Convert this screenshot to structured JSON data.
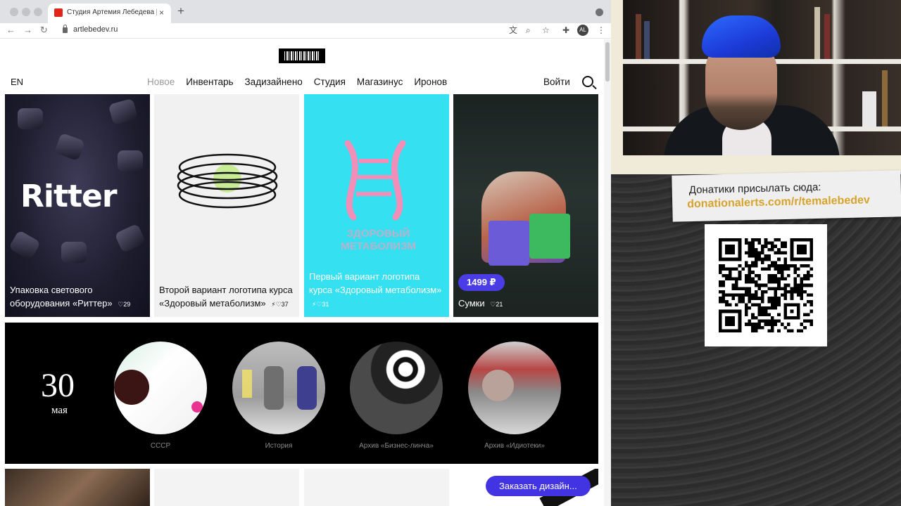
{
  "browser": {
    "tab_title": "Студия Артемия Лебедева | Z",
    "tab_close": "×",
    "new_tab": "+",
    "url": "artlebedev.ru",
    "avatar_initials": "AL",
    "icons": {
      "back": "←",
      "forward": "→",
      "reload": "↻",
      "translate": "文",
      "zoom": "⌕",
      "star": "☆",
      "extensions": "✚",
      "menu": "⋮"
    }
  },
  "site": {
    "lang": "EN",
    "nav": [
      "Новое",
      "Инвентарь",
      "Задизайнено",
      "Студия",
      "Магазинус",
      "Иронов"
    ],
    "nav_active": "Новое",
    "login": "Войти",
    "cards": [
      {
        "caption": "Упаковка светового оборудования «Риттер»",
        "likes": "29",
        "logo_text": "Ritter"
      },
      {
        "caption": "Второй вариант логотипа курса «Здоровый метаболизм»",
        "likes": "37"
      },
      {
        "caption": "Первый вариант логотипа курса «Здоровый метаболизм»",
        "likes": "31",
        "art_text": "ЗДОРОВЫЙ МЕТАБОЛИЗМ"
      },
      {
        "caption": "Сумки",
        "likes": "21",
        "price": "1499 ₽"
      }
    ],
    "archive": {
      "day": "30",
      "month": "мая",
      "items": [
        "СССР",
        "История",
        "Архив «Бизнес-линча»",
        "Архив «Идиотеки»"
      ]
    },
    "order_button": "Заказать дизайн..."
  },
  "stream": {
    "donation_line1": "Донатики присылать сюда:",
    "donation_line2": "donationalerts.com/r/temalebedev"
  },
  "colors": {
    "accent_button": "#4334e3",
    "price_badge": "#4a3de6",
    "cyan_card": "#35e0f0",
    "donation_link": "#d7a32b",
    "logo_red": "#e1251b"
  }
}
